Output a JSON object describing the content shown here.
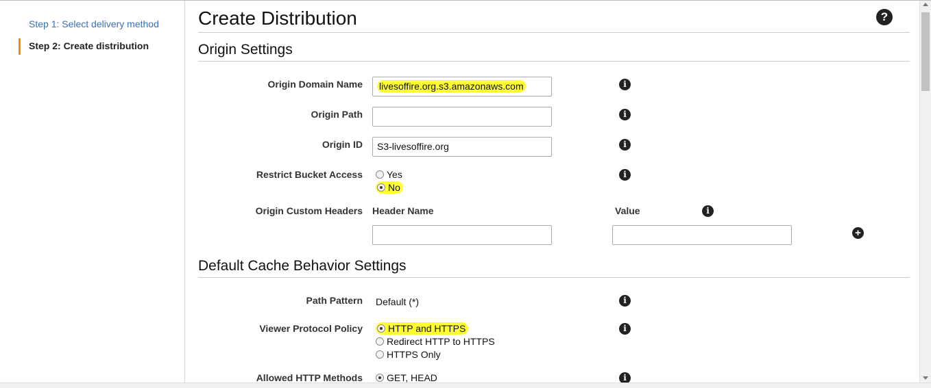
{
  "sidebar": {
    "step1": "Step 1: Select delivery method",
    "step2": "Step 2: Create distribution"
  },
  "page_title": "Create Distribution",
  "help_icon": "?",
  "origin_settings": {
    "title": "Origin Settings",
    "origin_domain_name": {
      "label": "Origin Domain Name",
      "value": "livesoffire.org.s3.amazonaws.com"
    },
    "origin_path": {
      "label": "Origin Path",
      "value": ""
    },
    "origin_id": {
      "label": "Origin ID",
      "value": "S3-livesoffire.org"
    },
    "restrict_bucket_access": {
      "label": "Restrict Bucket Access",
      "options": [
        "Yes",
        "No"
      ],
      "selected": "No"
    },
    "custom_headers": {
      "label": "Origin Custom Headers",
      "header_name_label": "Header Name",
      "value_label": "Value",
      "header_name": "",
      "header_value": ""
    }
  },
  "cache_behavior": {
    "title": "Default Cache Behavior Settings",
    "path_pattern": {
      "label": "Path Pattern",
      "value": "Default (*)"
    },
    "viewer_protocol_policy": {
      "label": "Viewer Protocol Policy",
      "options": [
        "HTTP and HTTPS",
        "Redirect HTTP to HTTPS",
        "HTTPS Only"
      ],
      "selected": "HTTP and HTTPS"
    },
    "allowed_methods": {
      "label": "Allowed HTTP Methods",
      "options": [
        "GET, HEAD"
      ],
      "selected": "GET, HEAD"
    }
  },
  "icons": {
    "info": "i",
    "add": "+"
  },
  "colors": {
    "highlight": "#ffff33",
    "accent": "#f08c00",
    "link": "#3a6fb0"
  }
}
